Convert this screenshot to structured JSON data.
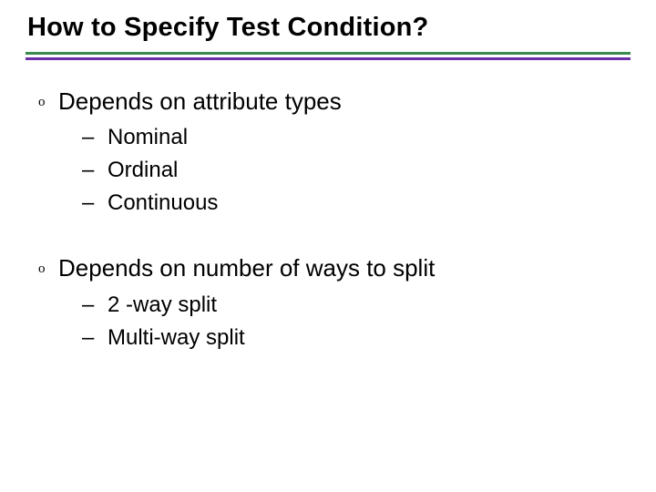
{
  "title": "How to Specify Test Condition?",
  "bullets": [
    {
      "marker": "o",
      "text": "Depends on attribute types",
      "sub": [
        {
          "dash": "–",
          "text": "Nominal"
        },
        {
          "dash": "–",
          "text": "Ordinal"
        },
        {
          "dash": "–",
          "text": "Continuous"
        }
      ]
    },
    {
      "marker": "o",
      "text": "Depends on number of ways to split",
      "sub": [
        {
          "dash": "–",
          "text": "2 -way split"
        },
        {
          "dash": "–",
          "text": "Multi-way split"
        }
      ]
    }
  ]
}
